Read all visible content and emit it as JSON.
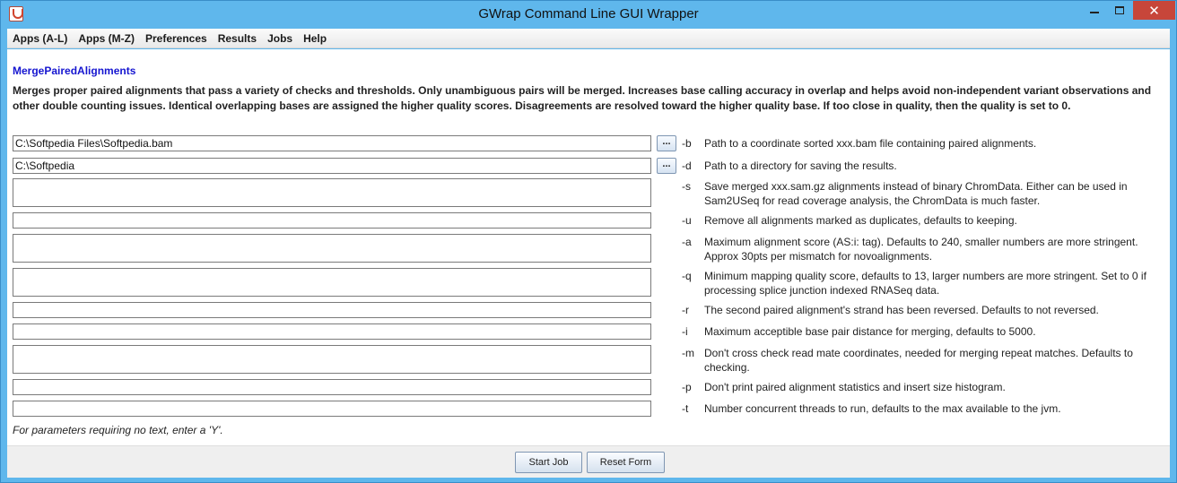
{
  "window": {
    "title": "GWrap Command Line GUI Wrapper",
    "minimize": "minimize",
    "maximize": "maximize",
    "close": "✕"
  },
  "menu": [
    "Apps (A-L)",
    "Apps (M-Z)",
    "Preferences",
    "Results",
    "Jobs",
    "Help"
  ],
  "tool": {
    "name": "MergePairedAlignments",
    "description": "Merges proper paired alignments that pass a variety of checks and thresholds. Only unambiguous pairs will be merged. Increases base calling accuracy in overlap and helps avoid non-independent variant observations and other double counting issues. Identical overlapping bases are assigned the higher quality scores. Disagreements are resolved toward the higher quality base. If too close in quality, then the quality is set to 0."
  },
  "params": [
    {
      "flag": "-b",
      "value": "C:\\Softpedia Files\\Softpedia.bam",
      "browse": "...",
      "desc": "Path to a coordinate sorted xxx.bam file containing paired alignments."
    },
    {
      "flag": "-d",
      "value": "C:\\Softpedia",
      "browse": "...",
      "desc": "Path to a directory for saving the results."
    },
    {
      "flag": "-s",
      "value": "",
      "desc": "Save merged xxx.sam.gz alignments instead of binary ChromData. Either can be used in Sam2USeq for read coverage analysis, the ChromData is much faster."
    },
    {
      "flag": "-u",
      "value": "",
      "desc": "Remove all alignments marked as duplicates, defaults to keeping."
    },
    {
      "flag": "-a",
      "value": "",
      "desc": "Maximum alignment score (AS:i: tag). Defaults to 240, smaller numbers are more stringent. Approx 30pts per mismatch for novoalignments."
    },
    {
      "flag": "-q",
      "value": "",
      "desc": "Minimum mapping quality score, defaults to 13, larger numbers are more stringent. Set to 0 if processing splice junction indexed RNASeq data."
    },
    {
      "flag": "-r",
      "value": "",
      "desc": "The second paired alignment's strand has been reversed. Defaults to not reversed."
    },
    {
      "flag": "-i",
      "value": "",
      "desc": "Maximum acceptible base pair distance for merging, defaults to 5000."
    },
    {
      "flag": "-m",
      "value": "",
      "desc": "Don't cross check read mate coordinates, needed for merging repeat matches. Defaults to checking."
    },
    {
      "flag": "-p",
      "value": "",
      "desc": "Don't print paired alignment statistics and insert size histogram."
    },
    {
      "flag": "-t",
      "value": "",
      "desc": "Number concurrent threads to run, defaults to the max available to the jvm."
    }
  ],
  "note": "For parameters requiring no text, enter a 'Y'.",
  "buttons": {
    "start": "Start Job",
    "reset": "Reset Form"
  }
}
